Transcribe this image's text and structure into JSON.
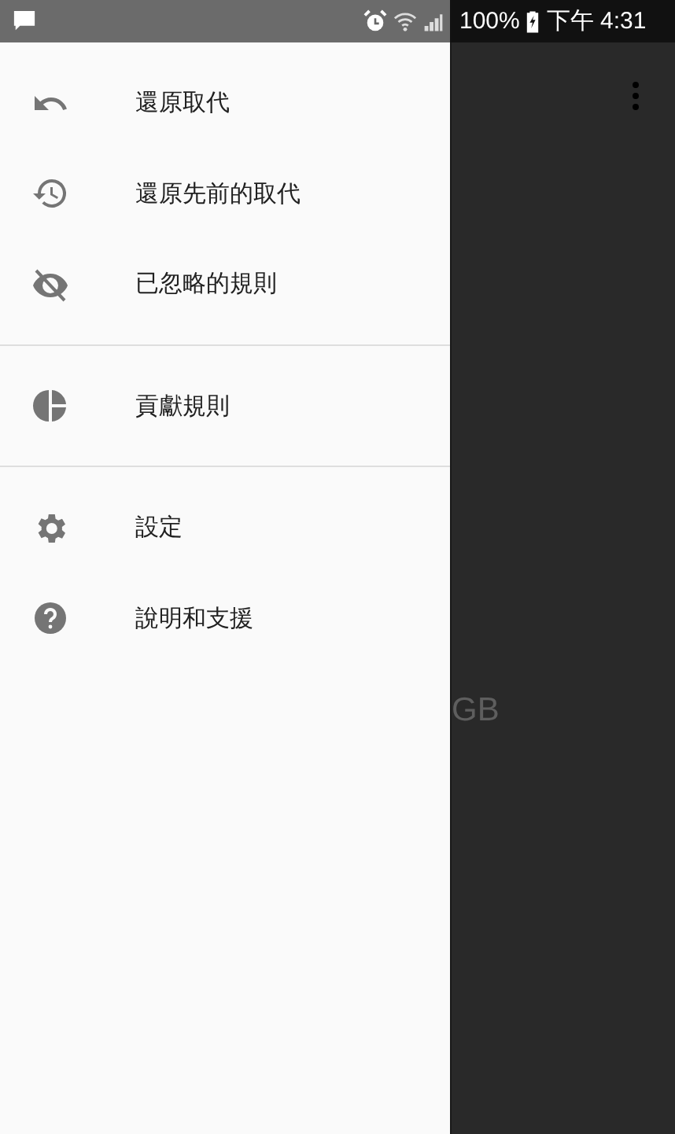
{
  "status_bar": {
    "battery": "100%",
    "time": "下午 4:31"
  },
  "drawer": {
    "sections": [
      {
        "items": [
          {
            "label": "還原取代",
            "kind": "undo"
          },
          {
            "label": "還原先前的取代",
            "kind": "history"
          },
          {
            "label": "已忽略的規則",
            "kind": "hidden"
          }
        ]
      },
      {
        "items": [
          {
            "label": "貢獻規則",
            "kind": "pie"
          }
        ]
      },
      {
        "items": [
          {
            "label": "設定",
            "kind": "settings"
          },
          {
            "label": "說明和支援",
            "kind": "help"
          }
        ]
      }
    ]
  },
  "background": {
    "text": "GB"
  }
}
